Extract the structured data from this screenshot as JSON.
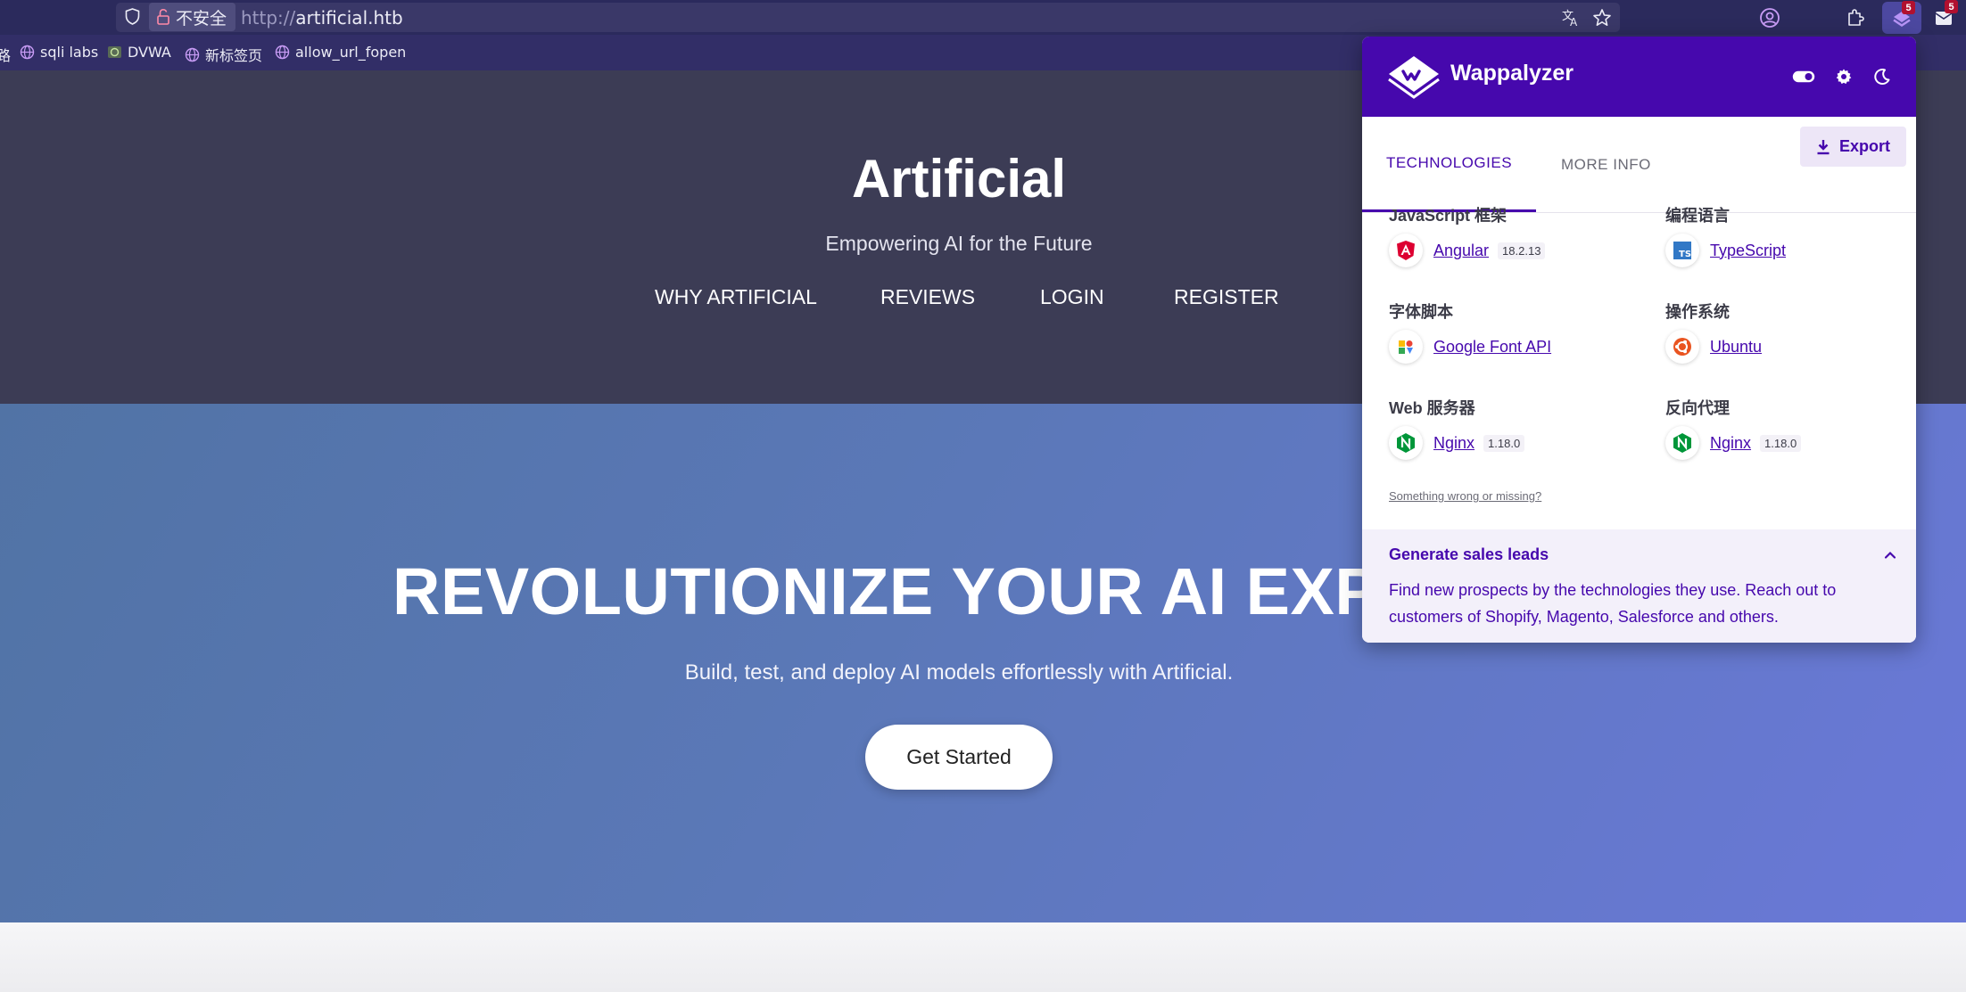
{
  "browser": {
    "insecure_label": "不安全",
    "url_scheme": "http://",
    "url_host": "artificial.htb",
    "extension_badge": "5",
    "mail_badge": "5",
    "bookmarks_prefix": "路",
    "bookmarks": [
      {
        "label": "sqli labs",
        "icon": "globe-icon"
      },
      {
        "label": "DVWA",
        "icon": "dvwa-icon"
      },
      {
        "label": "新标签页",
        "icon": "globe-icon"
      },
      {
        "label": "allow_url_fopen",
        "icon": "globe-icon"
      }
    ]
  },
  "site": {
    "brand": "Artificial",
    "tagline": "Empowering AI for the Future",
    "nav": [
      "WHY ARTIFICIAL",
      "REVIEWS",
      "LOGIN",
      "REGISTER"
    ],
    "hero_title": "REVOLUTIONIZE YOUR AI EXPERI",
    "hero_sub": "Build, test, and deploy AI models effortlessly with Artificial.",
    "cta": "Get Started"
  },
  "wappalyzer": {
    "name": "Wappalyzer",
    "tabs": [
      "TECHNOLOGIES",
      "MORE INFO"
    ],
    "export_label": "Export",
    "categories": [
      {
        "title": "JavaScript 框架",
        "tech": "Angular",
        "version": "18.2.13",
        "icon": "angular-icon"
      },
      {
        "title": "编程语言",
        "tech": "TypeScript",
        "version": "",
        "icon": "typescript-icon"
      },
      {
        "title": "字体脚本",
        "tech": "Google Font API",
        "version": "",
        "icon": "google-font-icon"
      },
      {
        "title": "操作系统",
        "tech": "Ubuntu",
        "version": "",
        "icon": "ubuntu-icon"
      },
      {
        "title": "Web 服务器",
        "tech": "Nginx",
        "version": "1.18.0",
        "icon": "nginx-icon"
      },
      {
        "title": "反向代理",
        "tech": "Nginx",
        "version": "1.18.0",
        "icon": "nginx-icon"
      }
    ],
    "wrong_link": "Something wrong or missing?",
    "leads_title": "Generate sales leads",
    "leads_text": "Find new prospects by the technologies they use. Reach out to customers of Shopify, Magento, Salesforce and others."
  },
  "colors": {
    "wappalyzer_purple": "#4608ad",
    "header_bg": "#3c3c55",
    "hero_gradient_start": "#5173a5",
    "hero_gradient_end": "#6a78d8"
  }
}
